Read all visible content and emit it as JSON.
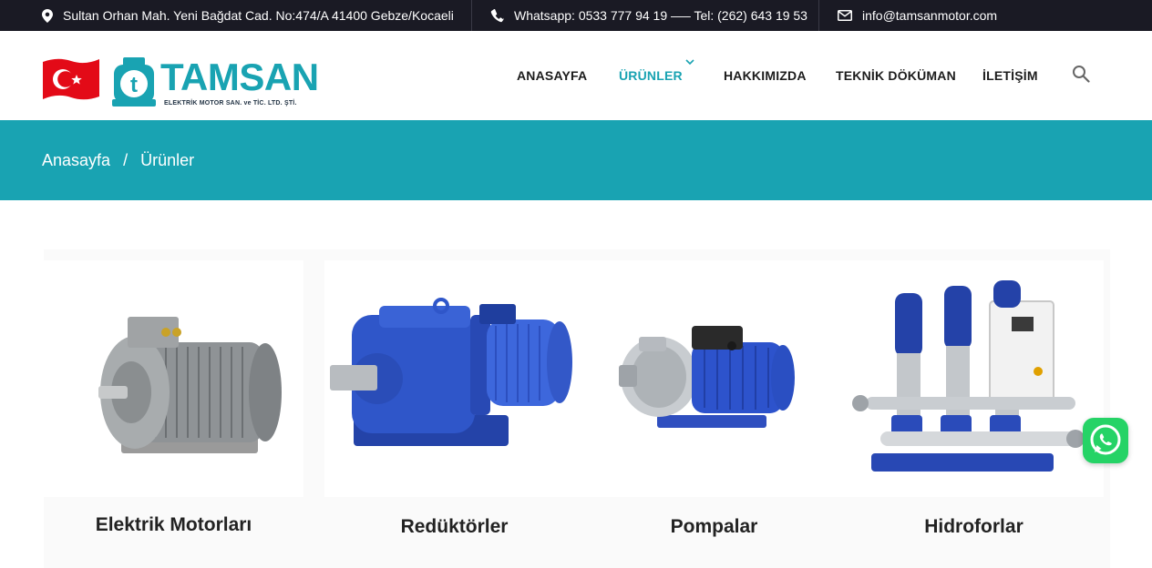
{
  "topbar": {
    "address": "Sultan Orhan Mah. Yeni Bağdat Cad. No:474/A 41400 Gebze/Kocaeli",
    "phones": "Whatsapp: 0533 777 94 19 —– Tel: (262) 643 19 53",
    "email": "info@tamsanmotor.com",
    "icons": [
      "map-pin-icon",
      "phone-icon",
      "envelope-icon"
    ]
  },
  "logo": {
    "name": "TAMSAN",
    "tagline": "ELEKTRİK MOTOR SAN. ve TİC. LTD. ŞTİ.",
    "brand_color": "#19a3b2",
    "flag_color": "#e30a17"
  },
  "nav": {
    "items": [
      {
        "label": "ANASAYFA"
      },
      {
        "label": "ÜRÜNLER",
        "active": true
      },
      {
        "label": "HAKKIMIZDA"
      },
      {
        "label": "TEKNİK DÖKÜMAN"
      },
      {
        "label": "İLETİŞİM"
      }
    ],
    "search_icon": "search-icon",
    "accent": "#19a3b2"
  },
  "breadcrumb": {
    "items": [
      "Anasayfa",
      "Ürünler"
    ],
    "separator": "/"
  },
  "products": [
    {
      "title": "Elektrik Motorları"
    },
    {
      "title": "Redüktörler"
    },
    {
      "title": "Pompalar"
    },
    {
      "title": "Hidroforlar"
    }
  ],
  "whatsapp": {
    "icon": "whatsapp-icon",
    "color": "#25d366"
  }
}
